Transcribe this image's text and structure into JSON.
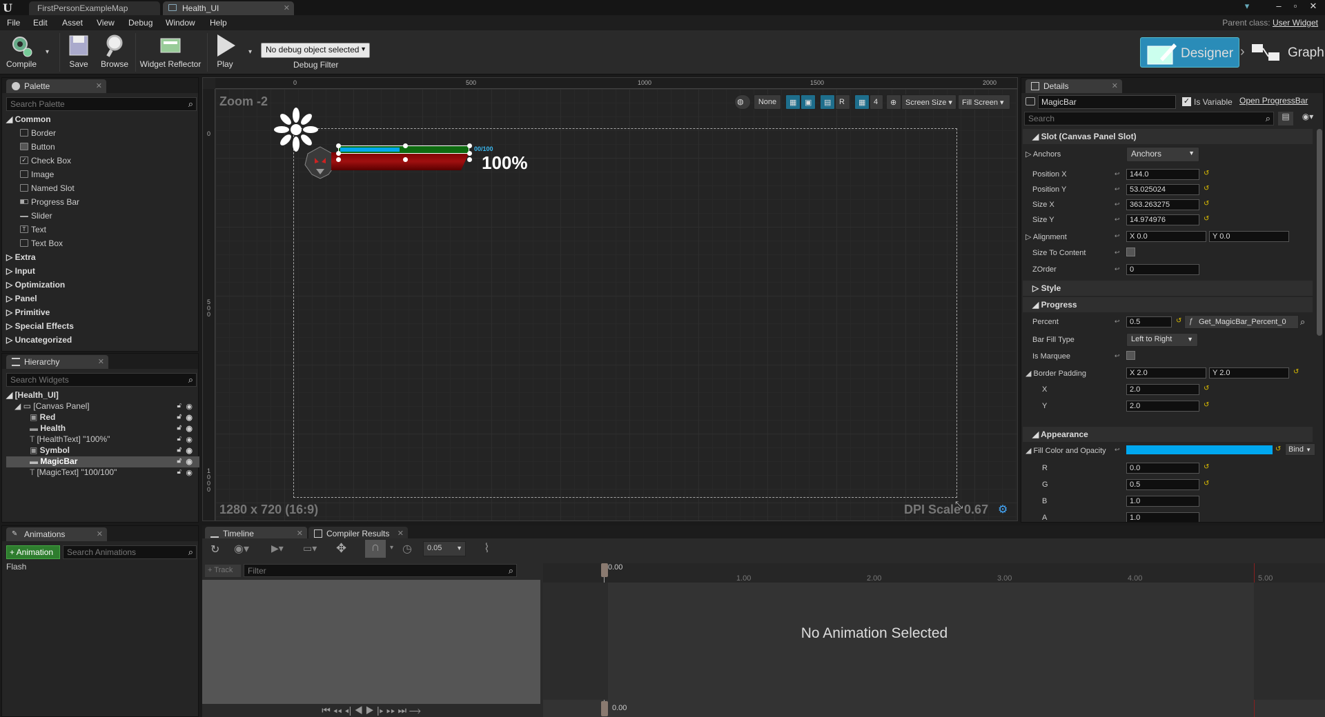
{
  "app": {
    "logo": "U",
    "tabs": [
      "FirstPersonExampleMap",
      "Health_UI"
    ],
    "menu": [
      "File",
      "Edit",
      "Asset",
      "View",
      "Debug",
      "Window",
      "Help"
    ],
    "parent_class_label": "Parent class:",
    "parent_class_value": "User Widget"
  },
  "toolbar": {
    "compile": "Compile",
    "save": "Save",
    "browse": "Browse",
    "widget_reflector": "Widget Reflector",
    "play": "Play",
    "debug_dropdown": "No debug object selected",
    "debug_filter": "Debug Filter",
    "designer": "Designer",
    "graph": "Graph",
    "accent_color": "#1e8bb4"
  },
  "palette": {
    "title": "Palette",
    "search_placeholder": "Search Palette",
    "common_label": "Common",
    "common_items": [
      "Border",
      "Button",
      "Check Box",
      "Image",
      "Named Slot",
      "Progress Bar",
      "Slider",
      "Text",
      "Text Box"
    ],
    "categories": [
      "Extra",
      "Input",
      "Optimization",
      "Panel",
      "Primitive",
      "Special Effects",
      "Uncategorized"
    ]
  },
  "hierarchy": {
    "title": "Hierarchy",
    "search_placeholder": "Search Widgets",
    "root": "[Health_UI]",
    "canvas": "[Canvas Panel]",
    "items": [
      "Red",
      "Health",
      "[HealthText] \"100%\"",
      "Symbol",
      "MagicBar",
      "[MagicText] \"100/100\""
    ],
    "selected": "MagicBar"
  },
  "viewport": {
    "zoom": "Zoom -2",
    "ruler_top": [
      "0",
      "500",
      "1000",
      "1500",
      "2000"
    ],
    "ruler_left": [
      "0",
      "5\n0\n0",
      "1\n0\n0\n0"
    ],
    "none_label": "None",
    "r_label": "R",
    "grid_num": "4",
    "screen_size": "Screen Size",
    "fill_screen": "Fill Screen",
    "resolution": "1280 x 720 (16:9)",
    "dpi": "DPI Scale 0.67",
    "magic_text": "00/100",
    "health_text": "100%"
  },
  "details": {
    "title": "Details",
    "name_value": "MagicBar",
    "is_variable": "Is Variable",
    "open_link": "Open ProgressBar",
    "search_placeholder": "Search",
    "slot_section": "Slot (Canvas Panel Slot)",
    "anchors_label": "Anchors",
    "anchors_value": "Anchors",
    "position_x_label": "Position X",
    "position_x": "144.0",
    "position_y_label": "Position Y",
    "position_y": "53.025024",
    "size_x_label": "Size X",
    "size_x": "363.263275",
    "size_y_label": "Size Y",
    "size_y": "14.974976",
    "alignment_label": "Alignment",
    "alignment_x": "X  0.0",
    "alignment_y": "Y  0.0",
    "size_to_content": "Size To Content",
    "zorder_label": "ZOrder",
    "zorder": "0",
    "style_section": "Style",
    "progress_section": "Progress",
    "percent_label": "Percent",
    "percent": "0.5",
    "percent_binding": "Get_MagicBar_Percent_0",
    "bar_fill_type_label": "Bar Fill Type",
    "bar_fill_type": "Left to Right",
    "is_marquee": "Is Marquee",
    "border_padding_label": "Border Padding",
    "border_padding_x": "X  2.0",
    "border_padding_y": "Y  2.0",
    "bp_x_label": "X",
    "bp_x": "2.0",
    "bp_y_label": "Y",
    "bp_y": "2.0",
    "appearance_section": "Appearance",
    "fill_color_label": "Fill Color and Opacity",
    "fill_color": "#00a8f0",
    "bind_label": "Bind",
    "r_label": "R",
    "r": "0.0",
    "g_label": "G",
    "g": "0.5",
    "b_label": "B",
    "b": "1.0",
    "a_label": "A",
    "a": "1.0"
  },
  "animations": {
    "title": "Animations",
    "add_button": "+ Animation",
    "search_placeholder": "Search Animations",
    "items": [
      "Flash"
    ]
  },
  "timeline": {
    "tab_timeline": "Timeline",
    "tab_compiler": "Compiler Results",
    "step_value": "0.05",
    "track_button": "+ Track",
    "filter_placeholder": "Filter",
    "time_start": "0.00",
    "ticks": [
      "1.00",
      "2.00",
      "3.00",
      "4.00",
      "5.00"
    ],
    "no_animation": "No Animation Selected"
  }
}
